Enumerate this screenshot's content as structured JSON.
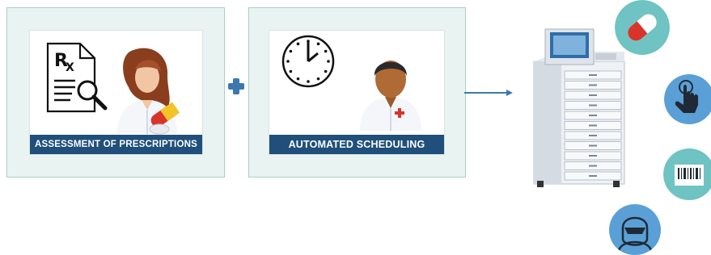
{
  "panels": [
    {
      "label": "ASSESSMENT OF PRESCRIPTIONS",
      "icon": "prescription-document-icon",
      "figure": "pharmacist-icon"
    },
    {
      "label": "AUTOMATED SCHEDULING",
      "icon": "clock-icon",
      "figure": "doctor-icon"
    }
  ],
  "connector_icons": [
    "plus-icon",
    "arrow-right-icon"
  ],
  "machine_icon": "dispensing-cabinet-icon",
  "feature_icons": [
    "pill-capsule-icon",
    "touch-hand-icon",
    "barcode-icon",
    "face-recognition-icon"
  ],
  "colors": {
    "panel_bg": "#e9f3f1",
    "panel_border": "#a9cfc8",
    "banner": "#1f4f7a",
    "accent_blue": "#3b78b0",
    "bubble_blue": "#5aa0d6",
    "bubble_teal": "#6fc3c2"
  }
}
